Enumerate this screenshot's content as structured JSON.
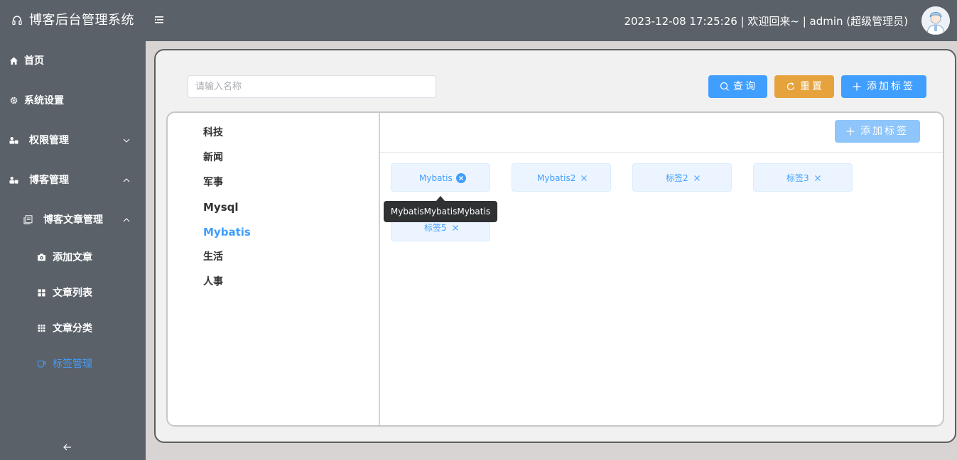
{
  "header": {
    "app_title": "博客后台管理系统",
    "userinfo": "2023-12-08 17:25:26 | 欢迎回来~ | admin (超级管理员)"
  },
  "sidebar": {
    "items": [
      {
        "label": "首页",
        "icon": "home-icon"
      },
      {
        "label": "系统设置",
        "icon": "gear-icon"
      },
      {
        "label": "权限管理",
        "icon": "user-group-icon",
        "expanded": false
      },
      {
        "label": "博客管理",
        "icon": "user-group-icon",
        "expanded": true
      },
      {
        "label": "博客文章管理",
        "icon": "document-icon",
        "expanded": true
      },
      {
        "label": "添加文章",
        "icon": "camera-icon"
      },
      {
        "label": "文章列表",
        "icon": "grid-icon"
      },
      {
        "label": "文章分类",
        "icon": "grid-dots-icon"
      },
      {
        "label": "标签管理",
        "icon": "cup-icon",
        "active": true
      }
    ]
  },
  "toolbar": {
    "search_placeholder": "请输入名称",
    "search_value": "",
    "query_label": "查询",
    "reset_label": "重置",
    "add_label": "添加标签"
  },
  "categories": [
    "科技",
    "新闻",
    "军事",
    "Mysql",
    "Mybatis",
    "生活",
    "人事"
  ],
  "selected_category": "Mybatis",
  "tag_panel": {
    "add_label": "添加标签",
    "tags": [
      "Mybatis",
      "Mybatis2",
      "标签2",
      "标签3",
      "标签5"
    ],
    "tooltip": "MybatisMybatisMybatis"
  },
  "colors": {
    "primary": "#409eff",
    "warning": "#e6a23c",
    "sidebar_bg": "#5a6168",
    "tag_bg": "#ecf5ff"
  }
}
